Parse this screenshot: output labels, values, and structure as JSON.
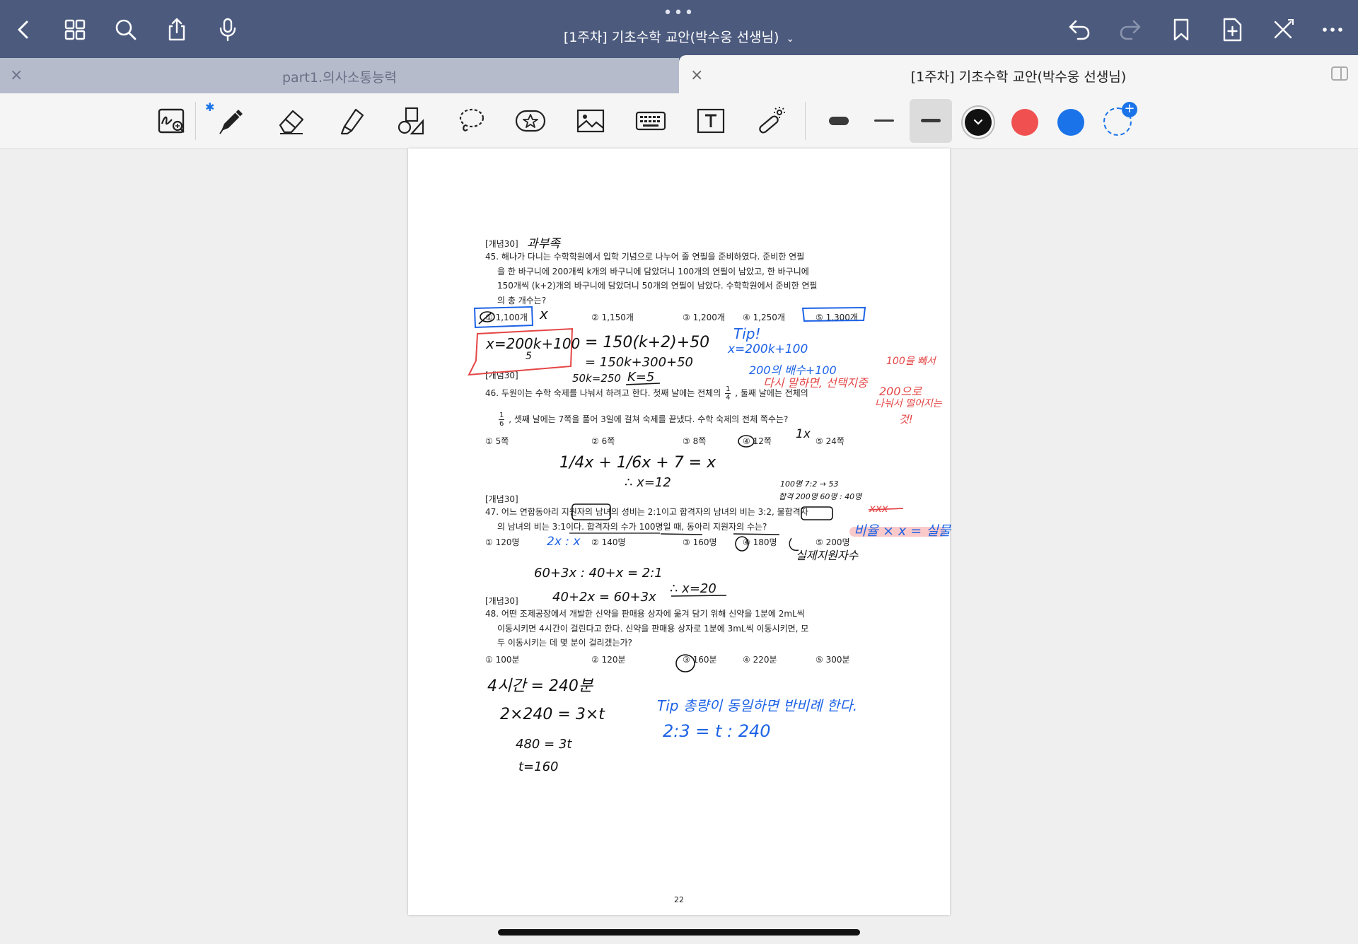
{
  "app": {
    "title": "[1주차] 기초수학 교안(박수웅 선생님)",
    "nav_icons": [
      "back-icon",
      "grid-icon",
      "search-icon",
      "share-icon",
      "microphone-icon"
    ],
    "right_icons": [
      "undo-icon",
      "redo-icon",
      "bookmark-icon",
      "add-page-icon",
      "close-edit-icon",
      "more-icon"
    ],
    "more_dots": "•••"
  },
  "tabs": [
    {
      "label": "part1.의사소통능력",
      "active": false,
      "close": "×"
    },
    {
      "label": "[1주차] 기초수학 교안(박수웅 선생님)",
      "active": true,
      "close": "×"
    }
  ],
  "toolbar": {
    "bluetooth": "✱",
    "tools": [
      "zoom-write-icon",
      "pen-icon",
      "eraser-icon",
      "highlighter-icon",
      "shapes-icon",
      "lasso-icon",
      "sticker-icon",
      "image-icon",
      "keyboard-icon",
      "text-box-icon",
      "laser-pointer-icon"
    ],
    "selected_tool": "pen-icon",
    "stroke_widths": [
      "thick",
      "thin",
      "medium"
    ],
    "selected_width": "medium",
    "colors": [
      "#111111",
      "#f05050",
      "#1a73e8"
    ],
    "selected_color": "#111111"
  },
  "document": {
    "page_number": "22",
    "q45": {
      "tag": "[개념30]",
      "line1": "45. 해나가 다니는 수학학원에서 입학 기념으로 나누어 줄 연필을 준비하였다. 준비한 연필",
      "line2": "을 한 바구니에 200개씩 k개의 바구니에 담았더니 100개의 연필이 남았고, 한 바구니에",
      "line3": "150개씩 (k+2)개의 바구니에 담았더니 50개의 연필이 남았다. 수학학원에서 준비한 연필",
      "line4": "의 총 개수는?",
      "options": [
        "① 1,100개",
        "② 1,150개",
        "③ 1,200개",
        "④ 1,250개",
        "⑤ 1,300개"
      ]
    },
    "q46": {
      "tag": "[개념30]",
      "line1a": "46. 두원이는 수학 숙제를 나눠서 하려고 한다. 첫째 날에는 전체의",
      "line1b": ", 둘째 날에는 전체의",
      "frac1_num": "1",
      "frac1_den": "4",
      "frac2_num": "1",
      "frac2_den": "6",
      "line2": ", 셋째 날에는 7쪽을 풀어 3일에 걸쳐 숙제를 끝냈다. 수학 숙제의 전체 쪽수는?",
      "options": [
        "① 5쪽",
        "② 6쪽",
        "③ 8쪽",
        "④ 12쪽",
        "⑤ 24쪽"
      ]
    },
    "q47": {
      "tag": "[개념30]",
      "line1": "47. 어느 연합동아리 지원자의 남녀의 성비는 2:1이고 합격자의 남녀의 비는 3:2, 불합격자",
      "line2": "의 남녀의 비는 3:1이다. 합격자의 수가 100명일 때, 동아리 지원자의 수는?",
      "options": [
        "① 120명",
        "② 140명",
        "③ 160명",
        "④ 180명",
        "⑤ 200명"
      ]
    },
    "q48": {
      "tag": "[개념30]",
      "line1": "48. 어떤 조제공장에서 개발한 신약을 판매용 상자에 옮겨 담기 위해 신약을 1분에 2mL씩",
      "line2": "이동시키면 4시간이 걸린다고 한다. 신약을 판매용 상자로 1분에 3mL씩 이동시키면, 모",
      "line3": "두 이동시키는 데 몇 분이 걸리겠는가?",
      "options": [
        "① 100분",
        "② 120분",
        "③ 160분",
        "④ 220분",
        "⑤ 300분"
      ]
    }
  },
  "handwriting": {
    "q45_note": "과부족",
    "q45_x": "x",
    "q45_eq1": "x=200k+100",
    "q45_eq1_sub": "5",
    "q45_eq2": "= 150(k+2)+50",
    "q45_eq3": "= 150k+300+50",
    "q45_eq4": "50k=250",
    "q45_eq5": "K=5",
    "tip1": "Tip!",
    "tip1_eq": "x=200k+100",
    "tip1_a": "200의 배수+100",
    "tip1_b": "다시 말하면, 선택지중",
    "red_a": "100을 빼서",
    "red_b": "200으로",
    "red_c": "나눠서 떨어지는",
    "red_d": "것!",
    "q46_1x": "1x",
    "q46_eq": "1/4x + 1/6x + 7 = x",
    "q46_ans": "∴ x=12",
    "q47_n1": "100명  7:2 → 53",
    "q47_n2": "합격 200명  60명 : 40명",
    "q47_cross": "xxx",
    "q47_ratio": "2x : x",
    "q47_note": "비율 × x = 실물",
    "q47_sub": "실제지원자수",
    "q47_eq1": "60+3x : 40+x = 2:1",
    "q47_eq2": "40+2x = 60+3x",
    "q47_ans": "∴ x=20",
    "q48_eq1": "4시간 = 240분",
    "q48_eq2": "2×240 = 3×t",
    "q48_eq3": "480 = 3t",
    "q48_eq4": "t=160",
    "tip2": "Tip  총량이 동일하면  반비례 한다.",
    "tip2_eq": "2:3 = t : 240"
  }
}
